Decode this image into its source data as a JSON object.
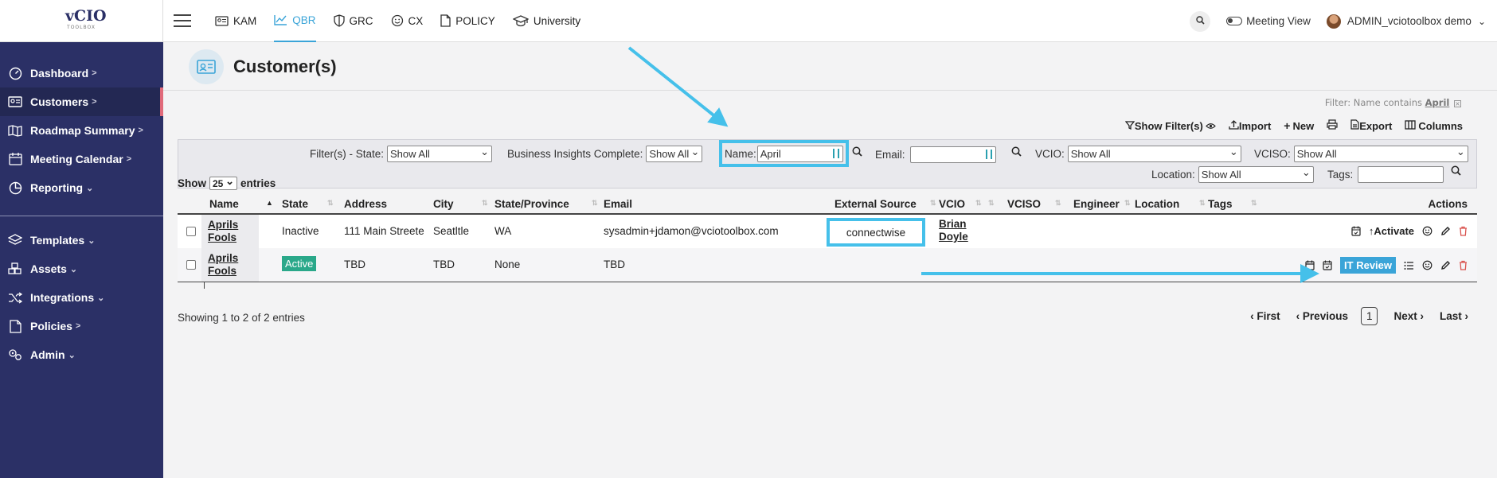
{
  "logo": {
    "mark": "vCIO",
    "tagline": "TOOLBOX"
  },
  "sidebar": {
    "items": [
      {
        "label": "Dashboard",
        "chevron": ">",
        "icon": "gauge-icon"
      },
      {
        "label": "Customers",
        "chevron": ">",
        "icon": "id-card-icon",
        "active": true
      },
      {
        "label": "Roadmap Summary",
        "chevron": ">",
        "icon": "map-icon"
      },
      {
        "label": "Meeting Calendar",
        "chevron": ">",
        "icon": "calendar-icon"
      },
      {
        "label": "Reporting",
        "chevron": "⌄",
        "icon": "chart-pie-icon"
      },
      {
        "label": "Templates",
        "chevron": "⌄",
        "icon": "layers-icon"
      },
      {
        "label": "Assets",
        "chevron": "⌄",
        "icon": "cubes-icon"
      },
      {
        "label": "Integrations",
        "chevron": "⌄",
        "icon": "shuffle-icon"
      },
      {
        "label": "Policies",
        "chevron": ">",
        "icon": "document-icon"
      },
      {
        "label": "Admin",
        "chevron": "⌄",
        "icon": "gears-icon"
      }
    ]
  },
  "topnav": {
    "items": [
      {
        "label": "KAM",
        "icon": "id-card-icon"
      },
      {
        "label": "QBR",
        "icon": "line-chart-icon",
        "active": true
      },
      {
        "label": "GRC",
        "icon": "shield-icon"
      },
      {
        "label": "CX",
        "icon": "smile-icon"
      },
      {
        "label": "POLICY",
        "icon": "document-icon"
      },
      {
        "label": "University",
        "icon": "graduation-cap-icon"
      }
    ],
    "search_label": "Q...",
    "meeting_view": "Meeting View",
    "user": "ADMIN_vciotoolbox demo",
    "user_chevron": "⌄"
  },
  "page": {
    "title": "Customer(s)",
    "filter_note_prefix": "Filter: Name contains",
    "filter_note_value": "April",
    "toolbar": {
      "show_filters": "Show Filter(s)",
      "import": "Import",
      "new": "New",
      "export": "Export",
      "columns": "Columns"
    }
  },
  "filters": {
    "state_label": "Filter(s) - State:",
    "state_value": "Show All",
    "bi_label": "Business Insights Complete:",
    "bi_value": "Show All",
    "name_label": "Name:",
    "name_value": "April",
    "email_label": "Email:",
    "email_value": "",
    "vcio_label": "VCIO:",
    "vcio_value": "Show All",
    "vciso_label": "VCISO:",
    "vciso_value": "Show All",
    "location_label": "Location:",
    "location_value": "Show All",
    "tags_label": "Tags:",
    "tags_value": ""
  },
  "entries": {
    "show": "Show",
    "count": "25",
    "suffix": "entries"
  },
  "table": {
    "headers": [
      "Name",
      "State",
      "Address",
      "City",
      "State/Province",
      "Email",
      "External Source",
      "VCIO",
      "VCISO",
      "Engineer",
      "Location",
      "Tags",
      "Actions"
    ],
    "rows": [
      {
        "name_line1": "Aprils",
        "name_line2": "Fools",
        "state": "Inactive",
        "address": "111 Main Streete",
        "city": "Seatltle",
        "province": "WA",
        "email": "sysadmin+jdamon@vciotoolbox.com",
        "external_source": "connectwise",
        "vcio_line1": "Brian",
        "vcio_line2": "Doyle",
        "action_label": "Activate"
      },
      {
        "name_line1": "Aprils",
        "name_line2": "Fools",
        "state": "Active",
        "address": "TBD",
        "city": "TBD",
        "province": "None",
        "email": "TBD",
        "action_label": "IT Review"
      }
    ]
  },
  "footer": {
    "showing": "Showing 1 to 2 of 2 entries",
    "first": "First",
    "previous": "Previous",
    "page": "1",
    "next": "Next",
    "last": "Last"
  },
  "colors": {
    "sidebar": "#2b3066",
    "accent": "#3aa4d8",
    "annotation": "#45c0ea",
    "active_badge": "#2aa88a",
    "delete": "#d9534f"
  }
}
